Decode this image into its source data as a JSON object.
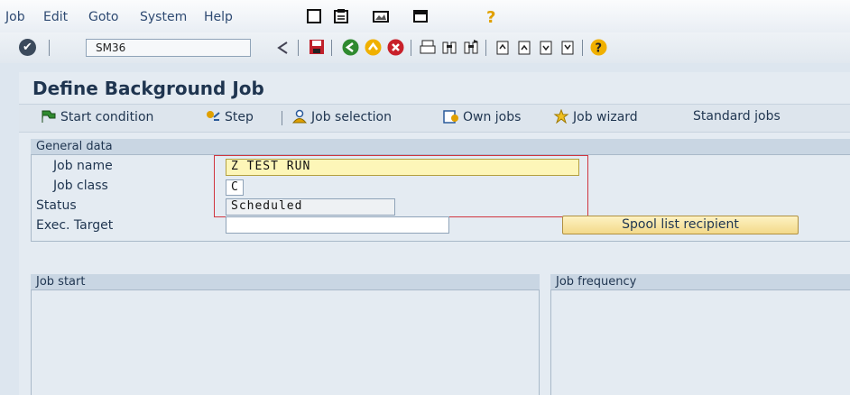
{
  "menubar": {
    "items": [
      "Job",
      "Edit",
      "Goto",
      "System",
      "Help"
    ],
    "icons": [
      "new-session-icon",
      "shortcut-icon",
      "layout-icon",
      "window-icon",
      "help-question-icon"
    ]
  },
  "command_bar": {
    "command": "SM36",
    "icons": [
      "back-icon",
      "save-icon",
      "back-green-icon",
      "exit-icon",
      "cancel-icon",
      "print-icon",
      "find-icon",
      "find-next-icon",
      "first-page-icon",
      "previous-page-icon",
      "next-page-icon",
      "last-page-icon",
      "help-icon"
    ]
  },
  "page": {
    "title": "Define Background Job"
  },
  "toolbar": {
    "start_condition": "Start condition",
    "step": "Step",
    "job_selection": "Job selection",
    "own_jobs": "Own jobs",
    "job_wizard": "Job wizard",
    "standard_jobs": "Standard jobs"
  },
  "general_data": {
    "heading": "General data",
    "job_name_label": "Job name",
    "job_name_value": "Z TEST RUN",
    "job_class_label": "Job class",
    "job_class_value": "C",
    "status_label": "Status",
    "status_value": "Scheduled",
    "exec_target_label": "Exec. Target",
    "exec_target_value": "",
    "spool_button": "Spool list recipient"
  },
  "job_start": {
    "heading": "Job start"
  },
  "job_frequency": {
    "heading": "Job frequency"
  },
  "colors": {
    "highlight_border": "#d0353f",
    "input_highlight": "#fdf6b8",
    "spool_button": "#f3d98a"
  }
}
